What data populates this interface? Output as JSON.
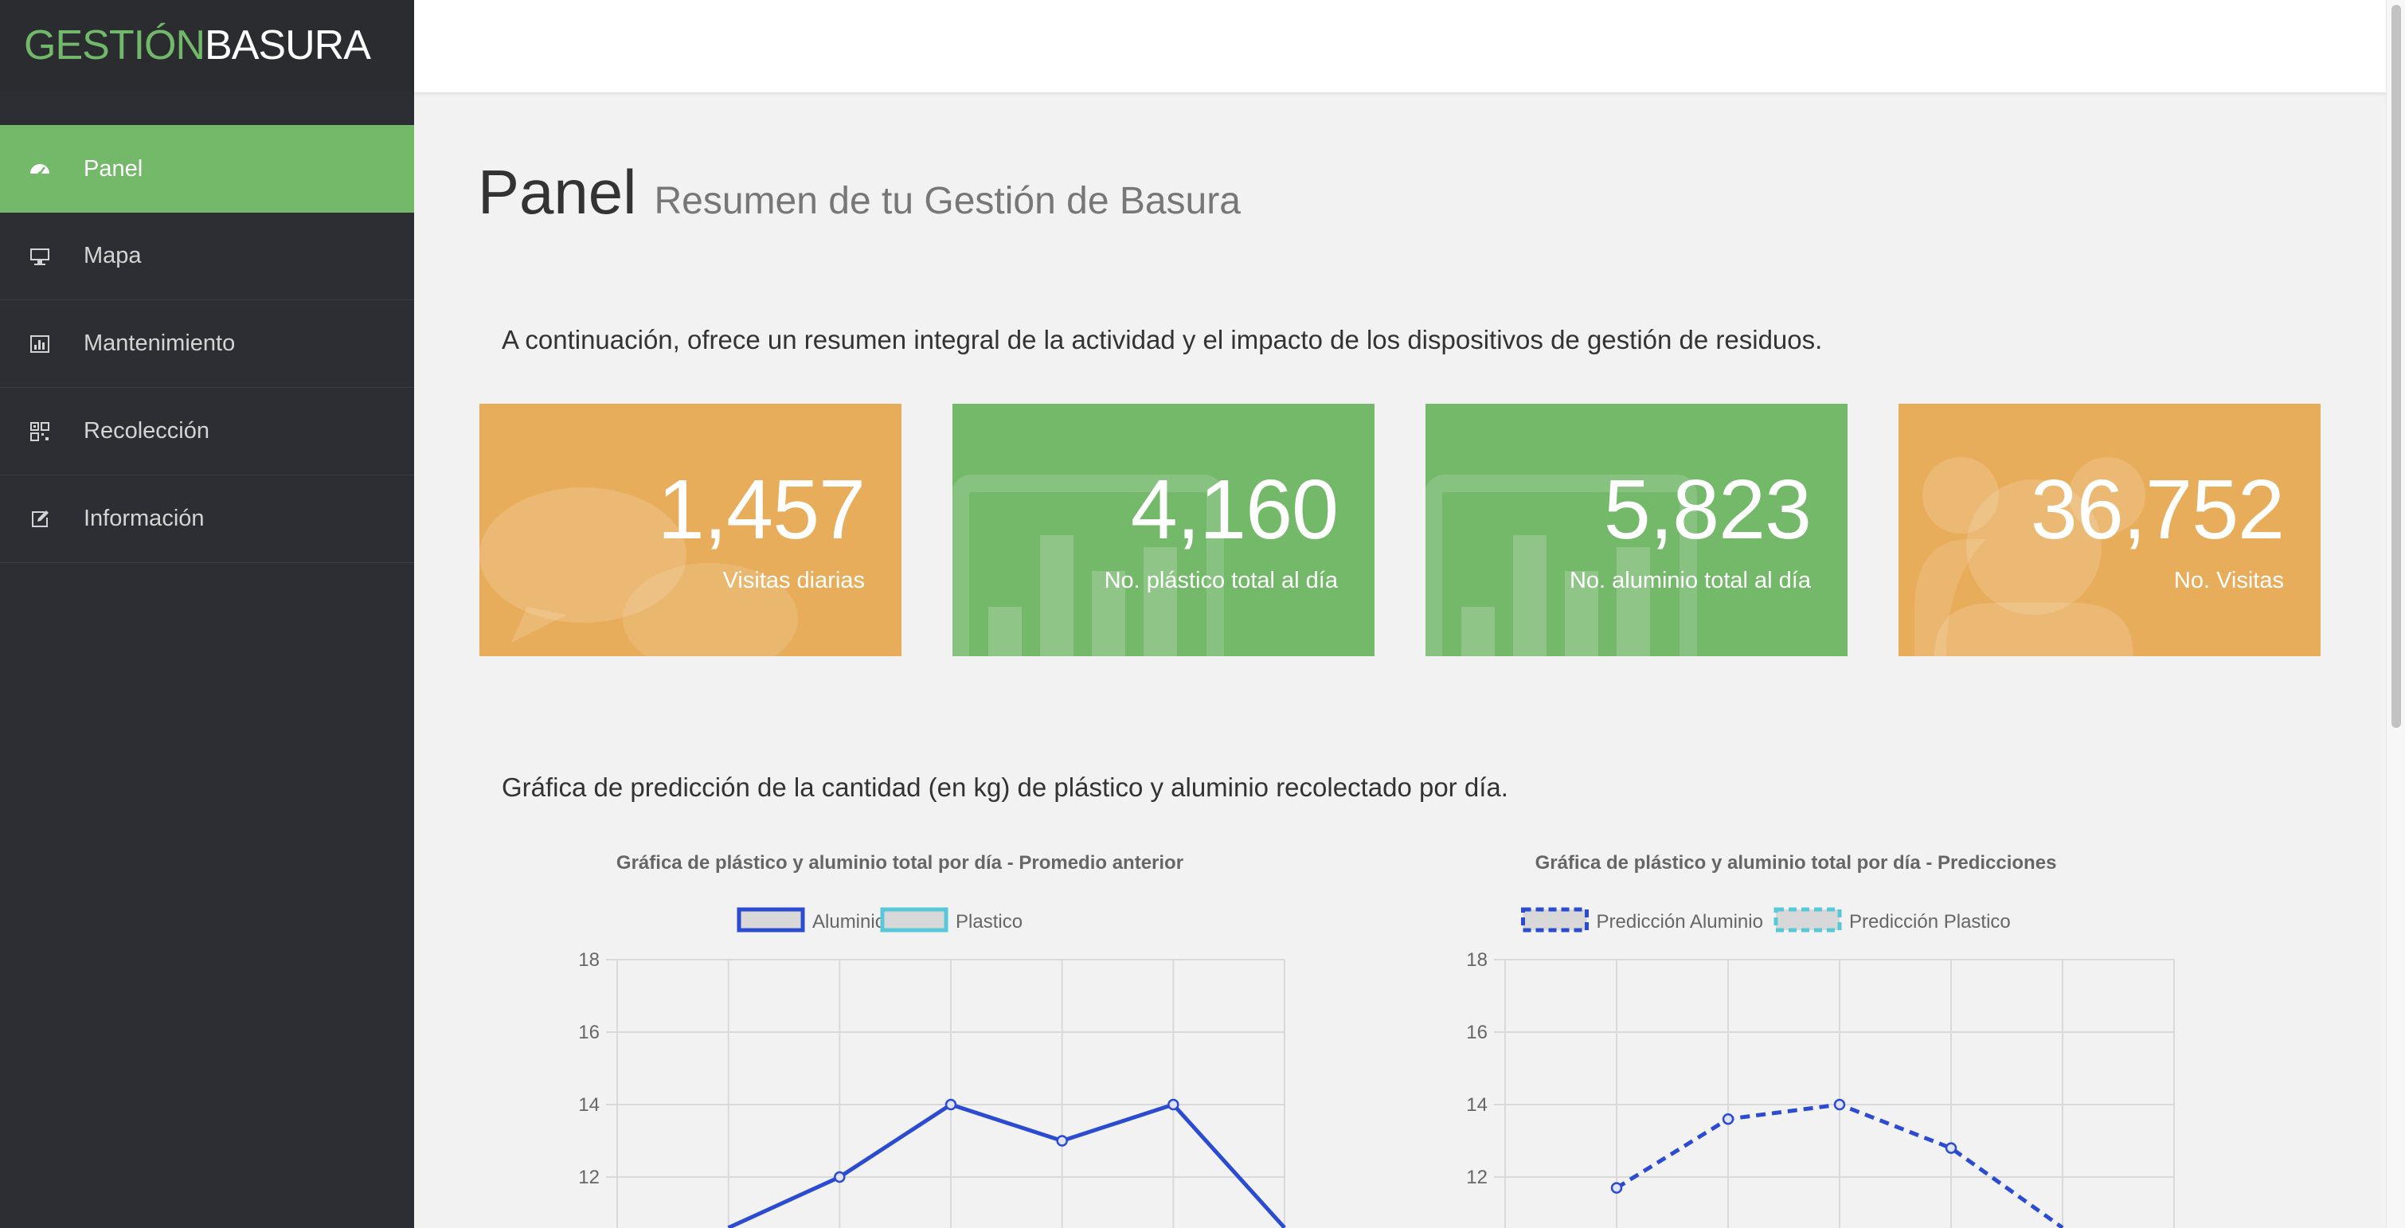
{
  "brand": {
    "part1": "GESTIÓN",
    "part2": "BASURA"
  },
  "sidebar": {
    "items": [
      {
        "label": "Panel",
        "icon": "dashboard-icon",
        "active": true
      },
      {
        "label": "Mapa",
        "icon": "monitor-icon",
        "active": false
      },
      {
        "label": "Mantenimiento",
        "icon": "bar-chart-icon",
        "active": false
      },
      {
        "label": "Recolección",
        "icon": "qrcode-icon",
        "active": false
      },
      {
        "label": "Información",
        "icon": "edit-icon",
        "active": false
      }
    ]
  },
  "header": {
    "title": "Panel",
    "subtitle": "Resumen de tu Gestión de Basura"
  },
  "intro": "A continuación, ofrece un resumen integral de la actividad y el impacto de los dispositivos de gestión de residuos.",
  "stats": [
    {
      "value": "1,457",
      "label": "Visitas diarias",
      "color": "#e8ad5b",
      "icon": "comments-icon"
    },
    {
      "value": "4,160",
      "label": "No. plástico total al día",
      "color": "#74b86a",
      "icon": "bar-chart-icon"
    },
    {
      "value": "5,823",
      "label": "No. aluminio total al día",
      "color": "#74b86a",
      "icon": "bar-chart-icon"
    },
    {
      "value": "36,752",
      "label": "No. Visitas",
      "color": "#e8ad5b",
      "icon": "users-icon"
    }
  ],
  "chart_intro": "Gráfica de predicción de la cantidad (en kg) de plástico y aluminio recolectado por día.",
  "chart_data": [
    {
      "type": "line",
      "title": "Gráfica de plástico y aluminio total por día - Promedio anterior",
      "y_ticks": [
        12,
        14,
        16,
        18
      ],
      "ylim_visible": [
        11,
        18
      ],
      "x_count": 7,
      "series": [
        {
          "name": "Aluminio",
          "color": "#2b4bd1",
          "dashed": false,
          "values": [
            null,
            10.6,
            12,
            14,
            13,
            14,
            10.6
          ]
        },
        {
          "name": "Plastico",
          "color": "#57c8d8",
          "dashed": false,
          "values": []
        }
      ]
    },
    {
      "type": "line",
      "title": "Gráfica de plástico y aluminio total por día - Predicciones",
      "y_ticks": [
        12,
        14,
        16,
        18
      ],
      "ylim_visible": [
        11,
        18
      ],
      "x_count": 7,
      "series": [
        {
          "name": "Predicción Aluminio",
          "color": "#2b4bd1",
          "dashed": true,
          "values": [
            null,
            11.7,
            13.6,
            14,
            12.8,
            10.6,
            null
          ]
        },
        {
          "name": "Predicción Plastico",
          "color": "#57c8d8",
          "dashed": true,
          "values": []
        }
      ]
    }
  ]
}
